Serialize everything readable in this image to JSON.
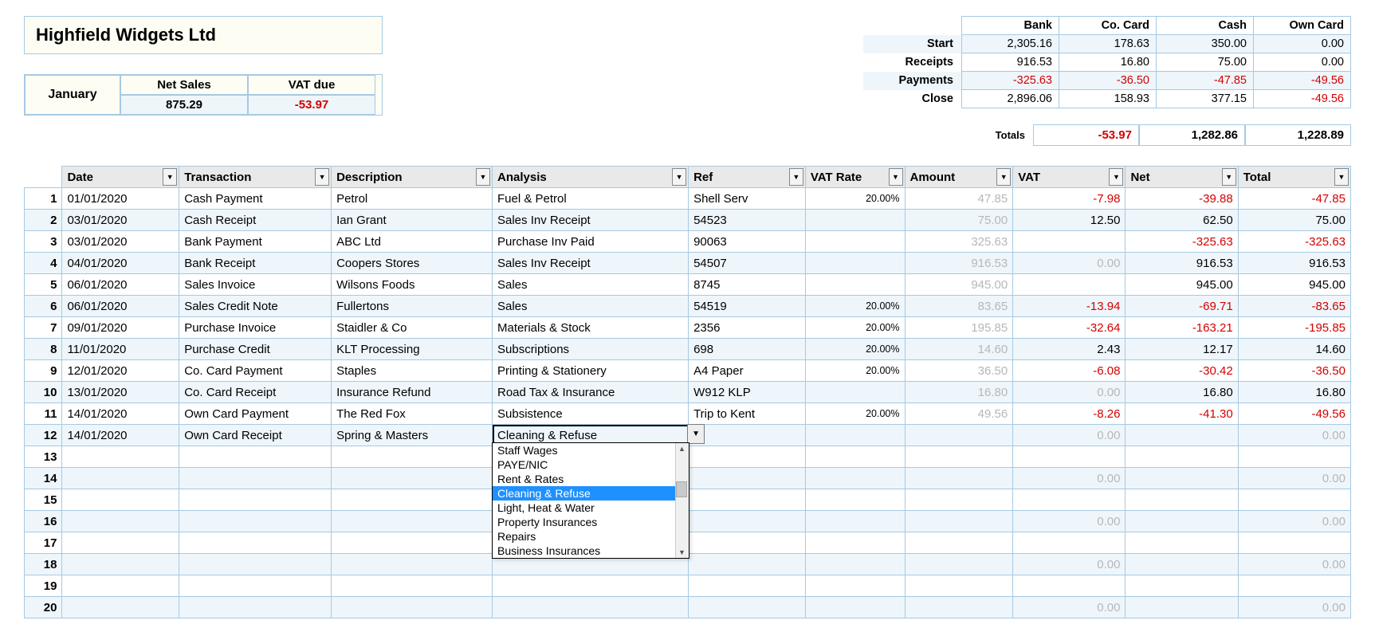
{
  "company": "Highfield Widgets Ltd",
  "month": "January",
  "monthBox": {
    "netSalesLabel": "Net Sales",
    "vatDueLabel": "VAT due",
    "netSales": "875.29",
    "vatDue": "-53.97"
  },
  "summary": {
    "cols": [
      "Bank",
      "Co. Card",
      "Cash",
      "Own Card"
    ],
    "rows": [
      {
        "label": "Start",
        "vals": [
          "2,305.16",
          "178.63",
          "350.00",
          "0.00"
        ],
        "neg": [
          false,
          false,
          false,
          false
        ]
      },
      {
        "label": "Receipts",
        "vals": [
          "916.53",
          "16.80",
          "75.00",
          "0.00"
        ],
        "neg": [
          false,
          false,
          false,
          false
        ]
      },
      {
        "label": "Payments",
        "vals": [
          "-325.63",
          "-36.50",
          "-47.85",
          "-49.56"
        ],
        "neg": [
          true,
          true,
          true,
          true
        ]
      },
      {
        "label": "Close",
        "vals": [
          "2,896.06",
          "158.93",
          "377.15",
          "-49.56"
        ],
        "neg": [
          false,
          false,
          false,
          true
        ]
      }
    ]
  },
  "totals": {
    "label": "Totals",
    "vals": [
      "-53.97",
      "1,282.86",
      "1,228.89"
    ],
    "neg": [
      true,
      false,
      false
    ]
  },
  "headers": [
    "Date",
    "Transaction",
    "Description",
    "Analysis",
    "Ref",
    "VAT Rate",
    "Amount",
    "VAT",
    "Net",
    "Total"
  ],
  "tx": [
    {
      "n": "1",
      "date": "01/01/2020",
      "txn": "Cash Payment",
      "desc": "Petrol",
      "ana": "Fuel & Petrol",
      "ref": "Shell Serv",
      "rate": "20.00%",
      "amt": "47.85",
      "vat": "-7.98",
      "net": "-39.88",
      "tot": "-47.85",
      "neg": {
        "vat": true,
        "net": true,
        "tot": true
      },
      "amtFaded": true
    },
    {
      "n": "2",
      "date": "03/01/2020",
      "txn": "Cash Receipt",
      "desc": "Ian Grant",
      "ana": "Sales Inv Receipt",
      "ref": "54523",
      "rate": "",
      "amt": "75.00",
      "vat": "12.50",
      "net": "62.50",
      "tot": "75.00",
      "neg": {},
      "amtFaded": true
    },
    {
      "n": "3",
      "date": "03/01/2020",
      "txn": "Bank Payment",
      "desc": "ABC Ltd",
      "ana": "Purchase Inv Paid",
      "ref": "90063",
      "rate": "",
      "amt": "325.63",
      "vat": "",
      "net": "-325.63",
      "tot": "-325.63",
      "neg": {
        "net": true,
        "tot": true
      },
      "amtFaded": true
    },
    {
      "n": "4",
      "date": "04/01/2020",
      "txn": "Bank Receipt",
      "desc": "Coopers Stores",
      "ana": "Sales Inv Receipt",
      "ref": "54507",
      "rate": "",
      "amt": "916.53",
      "vat": "0.00",
      "net": "916.53",
      "tot": "916.53",
      "neg": {},
      "amtFaded": true,
      "vatFaded": true
    },
    {
      "n": "5",
      "date": "06/01/2020",
      "txn": "Sales Invoice",
      "desc": "Wilsons Foods",
      "ana": "Sales",
      "ref": "8745",
      "rate": "",
      "amt": "945.00",
      "vat": "",
      "net": "945.00",
      "tot": "945.00",
      "neg": {},
      "amtFaded": true
    },
    {
      "n": "6",
      "date": "06/01/2020",
      "txn": "Sales Credit Note",
      "desc": "Fullertons",
      "ana": "Sales",
      "ref": "54519",
      "rate": "20.00%",
      "amt": "83.65",
      "vat": "-13.94",
      "net": "-69.71",
      "tot": "-83.65",
      "neg": {
        "vat": true,
        "net": true,
        "tot": true
      },
      "amtFaded": true
    },
    {
      "n": "7",
      "date": "09/01/2020",
      "txn": "Purchase Invoice",
      "desc": "Staidler & Co",
      "ana": "Materials & Stock",
      "ref": "2356",
      "rate": "20.00%",
      "amt": "195.85",
      "vat": "-32.64",
      "net": "-163.21",
      "tot": "-195.85",
      "neg": {
        "vat": true,
        "net": true,
        "tot": true
      },
      "amtFaded": true
    },
    {
      "n": "8",
      "date": "11/01/2020",
      "txn": "Purchase Credit",
      "desc": "KLT Processing",
      "ana": "Subscriptions",
      "ref": "698",
      "rate": "20.00%",
      "amt": "14.60",
      "vat": "2.43",
      "net": "12.17",
      "tot": "14.60",
      "neg": {},
      "amtFaded": true
    },
    {
      "n": "9",
      "date": "12/01/2020",
      "txn": "Co. Card Payment",
      "desc": "Staples",
      "ana": "Printing & Stationery",
      "ref": "A4 Paper",
      "rate": "20.00%",
      "amt": "36.50",
      "vat": "-6.08",
      "net": "-30.42",
      "tot": "-36.50",
      "neg": {
        "vat": true,
        "net": true,
        "tot": true
      },
      "amtFaded": true
    },
    {
      "n": "10",
      "date": "13/01/2020",
      "txn": "Co. Card Receipt",
      "desc": "Insurance Refund",
      "ana": "Road Tax & Insurance",
      "ref": "W912 KLP",
      "rate": "",
      "amt": "16.80",
      "vat": "0.00",
      "net": "16.80",
      "tot": "16.80",
      "neg": {},
      "amtFaded": true,
      "vatFaded": true
    },
    {
      "n": "11",
      "date": "14/01/2020",
      "txn": "Own Card Payment",
      "desc": "The Red Fox",
      "ana": "Subsistence",
      "ref": "Trip to Kent",
      "rate": "20.00%",
      "amt": "49.56",
      "vat": "-8.26",
      "net": "-41.30",
      "tot": "-49.56",
      "neg": {
        "vat": true,
        "net": true,
        "tot": true
      },
      "amtFaded": true
    },
    {
      "n": "12",
      "date": "14/01/2020",
      "txn": "Own Card Receipt",
      "desc": "Spring & Masters",
      "ana": "Cleaning & Refuse",
      "ref": "",
      "rate": "",
      "amt": "",
      "vat": "0.00",
      "net": "",
      "tot": "0.00",
      "neg": {},
      "vatFaded": true,
      "totFaded": true,
      "active": true
    },
    {
      "n": "13"
    },
    {
      "n": "14",
      "vat": "0.00",
      "tot": "0.00",
      "vatFaded": true,
      "totFaded": true
    },
    {
      "n": "15"
    },
    {
      "n": "16",
      "vat": "0.00",
      "tot": "0.00",
      "vatFaded": true,
      "totFaded": true
    },
    {
      "n": "17"
    },
    {
      "n": "18",
      "vat": "0.00",
      "tot": "0.00",
      "vatFaded": true,
      "totFaded": true
    },
    {
      "n": "19"
    },
    {
      "n": "20",
      "vat": "0.00",
      "tot": "0.00",
      "vatFaded": true,
      "totFaded": true
    }
  ],
  "dropdown": {
    "options": [
      "Staff Wages",
      "PAYE/NIC",
      "Rent & Rates",
      "Cleaning & Refuse",
      "Light, Heat & Water",
      "Property Insurances",
      "Repairs",
      "Business Insurances"
    ],
    "selected": "Cleaning & Refuse"
  }
}
